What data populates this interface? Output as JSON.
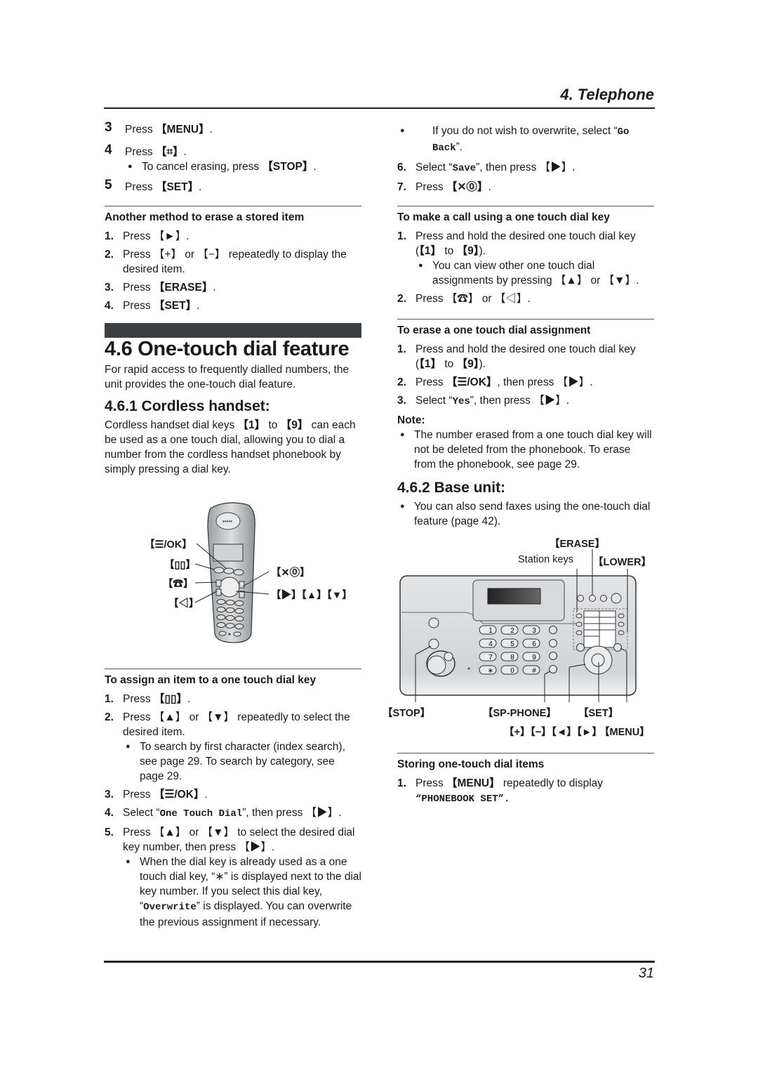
{
  "header": {
    "chapter": "4. Telephone"
  },
  "footer": {
    "page_number": "31"
  },
  "left_top": {
    "steps": [
      {
        "n": "3",
        "pre": "Press ",
        "key": "【MENU】",
        "post": "."
      },
      {
        "n": "4",
        "pre": "Press ",
        "key": "【⌗】",
        "post": ".",
        "bullet_pre": "To cancel erasing, press ",
        "bullet_key": "【STOP】",
        "bullet_post": "."
      },
      {
        "n": "5",
        "pre": "Press ",
        "key": "【SET】",
        "post": "."
      }
    ]
  },
  "another_method": {
    "title": "Another method to erase a stored item",
    "steps": [
      {
        "n": "1.",
        "text": "Press 【►】."
      },
      {
        "n": "2.",
        "text": "Press 【+】 or 【−】 repeatedly to display the desired item."
      },
      {
        "n": "3.",
        "pre": "Press ",
        "key": "【ERASE】",
        "post": "."
      },
      {
        "n": "4.",
        "pre": "Press ",
        "key": "【SET】",
        "post": "."
      }
    ]
  },
  "section": {
    "title": "4.6 One-touch dial feature",
    "intro": "For rapid access to frequently dialled numbers, the unit provides the one-touch dial feature."
  },
  "cordless": {
    "title": "4.6.1 Cordless handset:",
    "body_1": "Cordless handset dial keys ",
    "key_1": "【1】",
    "body_2": " to ",
    "key_9": "【9】",
    "body_3": " can each be used as a one touch dial, allowing you to dial a number from the cordless handset phonebook by simply pressing a dial key.",
    "figure_labels": {
      "menu_ok": "【☰/OK】",
      "phonebook": "【▯▯】",
      "talk": "【☎】",
      "speaker": "【◁】",
      "off_power": "【✕⓪】",
      "nav": "【▶】【▲】【▼】"
    }
  },
  "assign": {
    "title": "To assign an item to a one touch dial key",
    "s1_pre": "Press ",
    "s1_key": "【▯▯】",
    "s1_post": ".",
    "s2": "Press 【▲】 or 【▼】 repeatedly to select the desired item.",
    "s2_bullet": "To search by first character (index search), see page 29. To search by category, see page 29.",
    "s3_pre": "Press ",
    "s3_key": "【☰/OK】",
    "s3_post": ".",
    "s4_pre": "Select “",
    "s4_mono": "One Touch Dial",
    "s4_post": "”, then press 【▶】.",
    "s5": "Press 【▲】 or 【▼】 to select the desired dial key number, then press 【▶】.",
    "s5_b_1": "When the dial key is already used as a one touch dial key, “∗” is displayed next to the dial key number. If you select this dial key, “",
    "s5_b_mono": "Overwrite",
    "s5_b_2": "” is displayed. You can overwrite the previous assignment if necessary.",
    "b6_pre": "If you do not wish to overwrite, select “",
    "b6_mono": "Go Back",
    "b6_post": "”.",
    "s6_pre": "Select “",
    "s6_mono": "Save",
    "s6_post": "”, then press 【▶】.",
    "s7_pre": "Press ",
    "s7_key": "【✕⓪】",
    "s7_post": "."
  },
  "make_call": {
    "title": "To make a call using a one touch dial key",
    "s1": "Press and hold the desired one touch dial key (",
    "s1_k1": "【1】",
    "s1_to": " to ",
    "s1_k9": "【9】",
    "s1_end": ").",
    "s1_bullet": "You can view other one touch dial assignments by pressing 【▲】 or 【▼】.",
    "s2": "Press 【☎】 or 【◁】."
  },
  "erase": {
    "title": "To erase a one touch dial assignment",
    "s1": "Press and hold the desired one touch dial key (",
    "s1_k1": "【1】",
    "s1_to": " to ",
    "s1_k9": "【9】",
    "s1_end": ").",
    "s2_pre": "Press ",
    "s2_key": "【☰/OK】",
    "s2_post": ", then press 【▶】.",
    "s3_pre": "Select “",
    "s3_mono": "Yes",
    "s3_post": "”, then press 【▶】.",
    "note_label": "Note:",
    "note": "The number erased from a one touch dial key will not be deleted from the phonebook. To erase from the phonebook, see page 29."
  },
  "base": {
    "title": "4.6.2 Base unit:",
    "bullet": "You can also send faxes using the one-touch dial feature (page 42).",
    "figure_labels": {
      "erase": "【ERASE】",
      "station_keys": "Station keys",
      "lower": "【LOWER】",
      "stop": "【STOP】",
      "sp_phone": "【SP-PHONE】",
      "set": "【SET】",
      "nav": "【+】【−】【◄】【►】",
      "menu": "【MENU】"
    },
    "keypad": [
      "1",
      "2",
      "3",
      "4",
      "5",
      "6",
      "7",
      "8",
      "9",
      "∗",
      "0",
      "#"
    ]
  },
  "storing": {
    "title": "Storing one-touch dial items",
    "s1_pre": "Press ",
    "s1_key": "【MENU】",
    "s1_post": " repeatedly to display",
    "s1_mono": "“PHONEBOOK SET”."
  }
}
